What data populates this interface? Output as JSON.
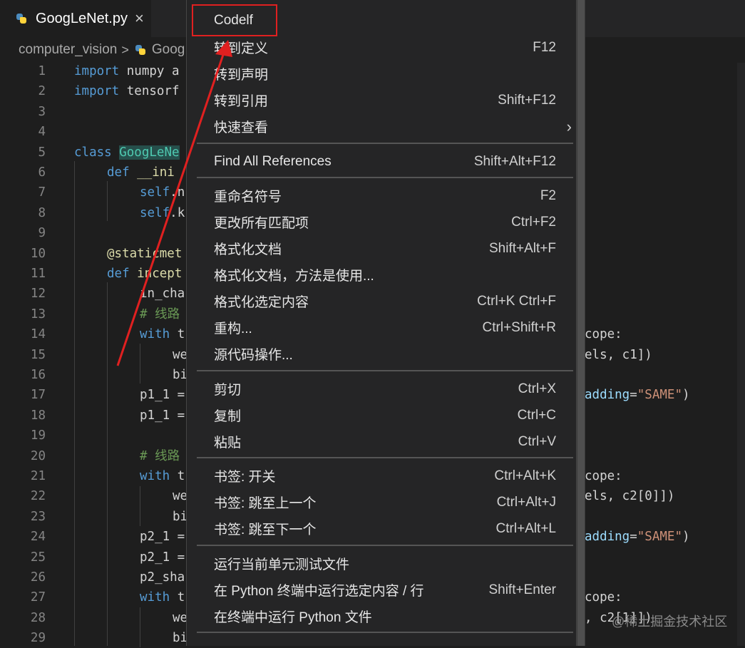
{
  "tab": {
    "title": "GoogLeNet.py",
    "close": "×"
  },
  "breadcrumb": {
    "folder": "computer_vision",
    "sep": ">",
    "file": "Goog"
  },
  "lines": [
    {
      "n": "1"
    },
    {
      "n": "2"
    },
    {
      "n": "3"
    },
    {
      "n": "4"
    },
    {
      "n": "5"
    },
    {
      "n": "6"
    },
    {
      "n": "7"
    },
    {
      "n": "8"
    },
    {
      "n": "9"
    },
    {
      "n": "10"
    },
    {
      "n": "11"
    },
    {
      "n": "12"
    },
    {
      "n": "13"
    },
    {
      "n": "14"
    },
    {
      "n": "15"
    },
    {
      "n": "16"
    },
    {
      "n": "17"
    },
    {
      "n": "18"
    },
    {
      "n": "19"
    },
    {
      "n": "20"
    },
    {
      "n": "21"
    },
    {
      "n": "22"
    },
    {
      "n": "23"
    },
    {
      "n": "24"
    },
    {
      "n": "25"
    },
    {
      "n": "26"
    },
    {
      "n": "27"
    },
    {
      "n": "28"
    },
    {
      "n": "29"
    }
  ],
  "code": {
    "l1_kw": "import",
    "l1_rest": " numpy a",
    "l2_kw": "import",
    "l2_rest": " tensorf",
    "l5_kw": "class",
    "l5_cls": "GoogLeNe",
    "l6_kw": "def",
    "l6_fn": " __ini",
    "l7_self": "self",
    "l7_rest": ".n",
    "l8_self": "self",
    "l8_rest": ".k",
    "l10_deco": "@staticmet",
    "l11_kw": "def",
    "l11_fn": " incept",
    "l12": "in_cha",
    "l13": "# 线路",
    "l14_kw": "with",
    "l14_rest": " t",
    "l14_right": "cope:",
    "l15": "we",
    "l15_right": "els, c1])",
    "l16": "bi",
    "l17": "p1_1 =",
    "l17_right_var": "adding",
    "l17_right_eq": "=",
    "l17_right_str": "\"SAME\"",
    "l17_right_end": ")",
    "l18": "p1_1 =",
    "l20": "# 线路",
    "l21_kw": "with",
    "l21_rest": " t",
    "l21_right": "cope:",
    "l22": "we",
    "l22_right": "els, c2[0]])",
    "l23": "bi",
    "l24": "p2_1 =",
    "l24_right_var": "adding",
    "l24_right_eq": "=",
    "l24_right_str": "\"SAME\"",
    "l24_right_end": ")",
    "l25": "p2_1 =",
    "l26": "p2_sha",
    "l27_kw": "with",
    "l27_rest": " t",
    "l27_right": "cope:",
    "l28": "we",
    "l28_right": ", c2[1]])",
    "l29": "bi"
  },
  "menu": {
    "items": [
      {
        "label": "Codelf",
        "key": ""
      },
      {
        "label": "转到定义",
        "key": "F12"
      },
      {
        "label": "转到声明",
        "key": ""
      },
      {
        "label": "转到引用",
        "key": "Shift+F12"
      },
      {
        "label": "快速查看",
        "key": "",
        "submenu": "›"
      },
      {
        "label": "Find All References",
        "key": "Shift+Alt+F12"
      },
      {
        "label": "重命名符号",
        "key": "F2"
      },
      {
        "label": "更改所有匹配项",
        "key": "Ctrl+F2"
      },
      {
        "label": "格式化文档",
        "key": "Shift+Alt+F"
      },
      {
        "label": "格式化文档，方法是使用...",
        "key": ""
      },
      {
        "label": "格式化选定内容",
        "key": "Ctrl+K Ctrl+F"
      },
      {
        "label": "重构...",
        "key": "Ctrl+Shift+R"
      },
      {
        "label": "源代码操作...",
        "key": ""
      },
      {
        "label": "剪切",
        "key": "Ctrl+X"
      },
      {
        "label": "复制",
        "key": "Ctrl+C"
      },
      {
        "label": "粘贴",
        "key": "Ctrl+V"
      },
      {
        "label": "书签: 开关",
        "key": "Ctrl+Alt+K"
      },
      {
        "label": "书签: 跳至上一个",
        "key": "Ctrl+Alt+J"
      },
      {
        "label": "书签: 跳至下一个",
        "key": "Ctrl+Alt+L"
      },
      {
        "label": "运行当前单元测试文件",
        "key": ""
      },
      {
        "label": "在 Python 终端中运行选定内容 / 行",
        "key": "Shift+Enter"
      },
      {
        "label": "在终端中运行 Python 文件",
        "key": ""
      }
    ]
  },
  "watermark": "@稀土掘金技术社区",
  "colors": {
    "highlight": "#e02020",
    "arrow": "#e02020"
  },
  "icons": {
    "file": "python-icon",
    "close": "close-icon",
    "submenu": "chevron-right-icon"
  }
}
